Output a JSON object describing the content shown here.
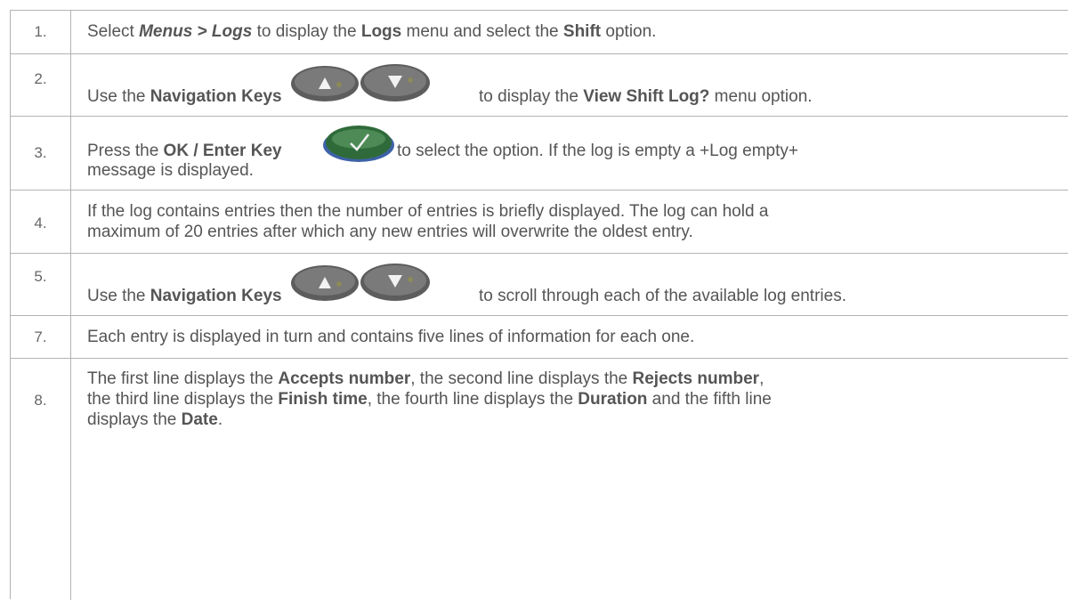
{
  "rows": [
    {
      "num": "1.",
      "t0": "Select ",
      "menus": "Menus > Logs",
      "t1": " to display the ",
      "logs": "Logs",
      "t2": " menu and select the ",
      "shift": "Shift",
      "t3": " option."
    },
    {
      "num": "2.",
      "t0": "Use the ",
      "nav_keys": "Navigation Keys",
      "t1": "to display the ",
      "view_shift": "View Shift Log?",
      "t2": " menu option."
    },
    {
      "num": "3.",
      "t0": "Press the ",
      "ok_key": "OK / Enter Key",
      "t1": " to select the option. If the log is empty a +Log empty+",
      "t2": "message is displayed."
    },
    {
      "num": "4.",
      "line1": "If the log contains entries then the number of entries is briefly displayed. The log can hold a",
      "line2": "maximum of 20 entries after which any new entries will overwrite the oldest entry."
    },
    {
      "num": "5.",
      "t0": "Use the ",
      "nav_keys": "Navigation Keys",
      "t1": "to scroll through each of the available log entries."
    },
    {
      "num": "7.",
      "line1": "Each entry is displayed in turn and contains five lines of information for each one."
    },
    {
      "num": "8.",
      "a0": "The first line displays the ",
      "a1": "Accepts number",
      "a2": ", the second line displays the ",
      "a3": "Rejects number",
      "a4": ",",
      "b0": "the third line displays the ",
      "b1": "Finish time",
      "b2": ", the fourth line displays the ",
      "b3": "Duration",
      "b4": " and the fifth line",
      "c0": "displays the ",
      "c1": "Date",
      "c2": "."
    }
  ],
  "icons": {
    "up_key": "navigation-up-key-icon",
    "down_key": "navigation-down-key-icon",
    "ok_key": "ok-enter-key-icon",
    "colors": {
      "key_grey": "#6e6e6e",
      "key_green": "#2f6b3a",
      "key_rim_blue": "#3e62a8"
    }
  }
}
